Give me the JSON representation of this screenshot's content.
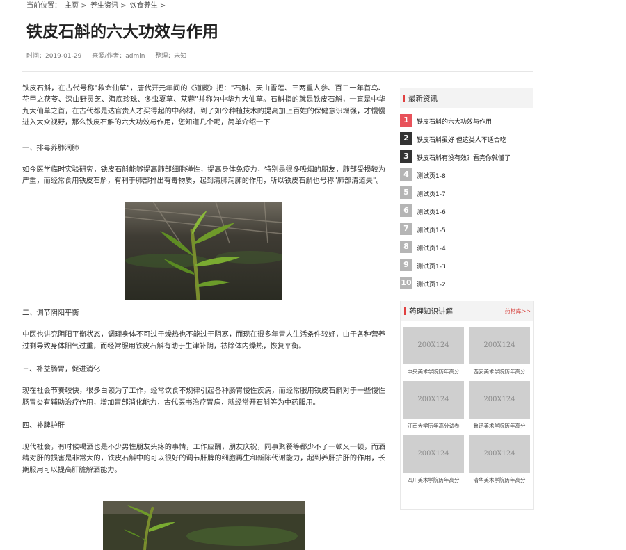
{
  "breadcrumb": {
    "prefix": "当前位置：",
    "items": [
      "主页",
      "养生资讯",
      "饮食养生"
    ],
    "sep": ">"
  },
  "article": {
    "title": "铁皮石斛的六大功效与作用",
    "meta": {
      "time": "时间：2019-01-29",
      "source": "来源/作者：admin",
      "editor": "整理：未知"
    },
    "intro": "铁皮石斛，在古代号称\"救命仙草\"，唐代开元年间的《道藏》把：\"石斛、天山雪莲、三两重人参、百二十年首乌、花甲之茯苓、深山野灵芝、海底珍珠、冬虫夏草、苁蓉\"并称为中华九大仙草。石斛指的就是铁皮石斛，一直是中华九大仙草之首，在古代都是达官贵人才买得起的中药材，到了如今种植技术的提高加上百姓的保健意识增强，才慢慢进入大众视野，那么铁皮石斛的六大功效与作用，您知道几个呢，简单介绍一下",
    "s1_title": "一、排毒养肺润肺",
    "s1_text": "如今医学临时实验研究，铁皮石斛能够提高肺部细胞弹性，提高身体免疫力，特别是很多吸烟的朋友，肺部受损较为严重，而经常食用铁皮石斛，有利于肺部排出有毒物质，起到清肺润肺的作用，所以铁皮石斛也号称\"肺部清道夫\"。",
    "s2_title": "二、调节阴阳平衡",
    "s2_text": "中医也讲究阴阳平衡状态，调理身体不可过于燥热也不能过于阴寒，而现在很多年青人生活条件较好，由于各种营养过剩导致身体阳气过重，而经常服用铁皮石斛有助于生津补阴，祛除体内燥热，恢复平衡。",
    "s3_title": "三、补益肠胃，促进消化",
    "s3_text": "现在社会节奏较快，很多白领为了工作，经常饮食不规律引起各种肠胃慢性疾病，而经常服用铁皮石斛对于一些慢性肠胃炎有辅助治疗作用，增加胃部消化能力，古代医书治疗胃病，就经常开石斛等为中药服用。",
    "s4_title": "四、补脾护肝",
    "s4_text": "现代社会，有时候喝酒也是不少男性朋友头疼的事情，工作应酬，朋友庆祝，同事聚餐等都少不了一顿又一顿，而酒精对肝的损害是非常大的，铁皮石斛中的可以很好的调节肝脾的细胞再生和新陈代谢能力，起到养肝护肝的作用，长期服用可以提高肝脏解酒能力。"
  },
  "latest": {
    "title": "最新资讯",
    "items": [
      {
        "num": "1",
        "label": "铁皮石斛的六大功效与作用",
        "color": "#e8525a"
      },
      {
        "num": "2",
        "label": "铁皮石斛虽好 但这类人不适合吃",
        "color": "#333333"
      },
      {
        "num": "3",
        "label": "铁皮石斛有没有效？看完你就懂了",
        "color": "#333333"
      },
      {
        "num": "4",
        "label": "测试页1-8",
        "color": "#b5b5b5"
      },
      {
        "num": "5",
        "label": "测试页1-7",
        "color": "#b5b5b5"
      },
      {
        "num": "6",
        "label": "测试页1-6",
        "color": "#b5b5b5"
      },
      {
        "num": "7",
        "label": "测试页1-5",
        "color": "#b5b5b5"
      },
      {
        "num": "8",
        "label": "测试页1-4",
        "color": "#b5b5b5"
      },
      {
        "num": "9",
        "label": "测试页1-3",
        "color": "#b5b5b5"
      },
      {
        "num": "10",
        "label": "测试页1-2",
        "color": "#b5b5b5"
      }
    ]
  },
  "pharma": {
    "title": "药理知识讲解",
    "more": "药材库>>",
    "items": [
      {
        "thumb": "200X124",
        "caption": "中央美术学院历年高分"
      },
      {
        "thumb": "200X124",
        "caption": "西安美术学院历年高分"
      },
      {
        "thumb": "200X124",
        "caption": "江南大学历年高分试卷"
      },
      {
        "thumb": "200X124",
        "caption": "鲁迅美术学院历年高分"
      },
      {
        "thumb": "200X124",
        "caption": "四川美术学院历年高分"
      },
      {
        "thumb": "200X124",
        "caption": "清华美术学院历年高分"
      }
    ]
  }
}
